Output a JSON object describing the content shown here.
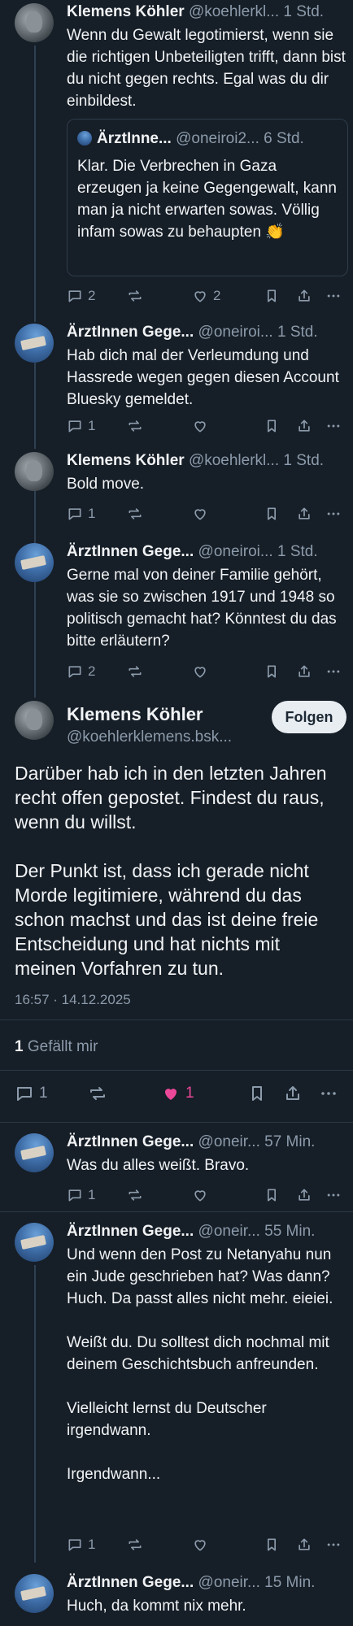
{
  "posts": [
    {
      "name": "Klemens Köhler",
      "handle": "@koehlerkl...",
      "time": "1 Std.",
      "text": "Wenn du Gewalt legotimierst, wenn sie die richtigen Unbeteiligten trifft, dann bist du nicht gegen rechts. Egal was du dir einbildest.",
      "quote": {
        "name": "ÄrztInne...",
        "handle": "@oneiroi2...",
        "time": "6 Std.",
        "text": "Klar. Die Verbrechen in Gaza erzeugen ja keine Gegengewalt, kann man ja nicht erwarten sowas. Völlig infam sowas zu behaupten 👏"
      },
      "replies": "2",
      "reposts": "",
      "likes": "2"
    },
    {
      "name": "ÄrztInnen Gege...",
      "handle": "@oneiroi...",
      "time": "1 Std.",
      "text": "Hab dich mal der Verleumdung und Hassrede wegen gegen diesen Account Bluesky gemeldet.",
      "replies": "1",
      "reposts": "",
      "likes": ""
    },
    {
      "name": "Klemens Köhler",
      "handle": "@koehlerkl...",
      "time": "1 Std.",
      "text": "Bold move.",
      "replies": "1",
      "reposts": "",
      "likes": ""
    },
    {
      "name": "ÄrztInnen Gege...",
      "handle": "@oneiroi...",
      "time": "1 Std.",
      "text": "Gerne mal von deiner Familie gehört, was sie so zwischen 1917 und 1948 so politisch gemacht hat? Könntest du das bitte erläutern?",
      "replies": "2",
      "reposts": "",
      "likes": ""
    }
  ],
  "focus": {
    "name": "Klemens Köhler",
    "handle": "@koehlerklemens.bsk...",
    "follow_label": "Folgen",
    "text": "Darüber hab ich in den letzten Jahren recht offen gepostet. Findest du raus, wenn du willst.\n\nDer Punkt ist, dass ich gerade nicht Morde legitimiere, während du das schon machst und das ist deine freie Entscheidung und hat nichts mit meinen Vorfahren zu tun.",
    "date": "16:57 · 14.12.2025",
    "likes_count": "1",
    "likes_label": "Gefällt mir",
    "replies": "1",
    "liked_count": "1",
    "like_color": "#ec4899"
  },
  "replies": [
    {
      "name": "ÄrztInnen Gege...",
      "handle": "@oneir...",
      "time": "57 Min.",
      "text": "Was du alles weißt.  Bravo.",
      "replies": "1"
    },
    {
      "name": "ÄrztInnen Gege...",
      "handle": "@oneir...",
      "time": "55 Min.",
      "text": "Und wenn den Post zu Netanyahu nun ein Jude geschrieben hat? Was dann? Huch. Da passt alles nicht mehr. eieiei.\n\nWeißt du. Du solltest dich nochmal mit deinem Geschichtsbuch anfreunden.\n\nVielleicht lernst du Deutscher irgendwann.\n\nIrgendwann...",
      "replies": "1"
    },
    {
      "name": "ÄrztInnen Gege...",
      "handle": "@oneir...",
      "time": "15 Min.",
      "text": "Huch, da kommt nix mehr.",
      "replies": ""
    }
  ],
  "icons": [
    "reply-icon",
    "repost-icon",
    "like-icon",
    "bookmark-icon",
    "share-icon",
    "more-icon"
  ],
  "colors": {
    "background": "#161e27",
    "muted": "#8c9bab",
    "thread_line": "#2e4052"
  }
}
